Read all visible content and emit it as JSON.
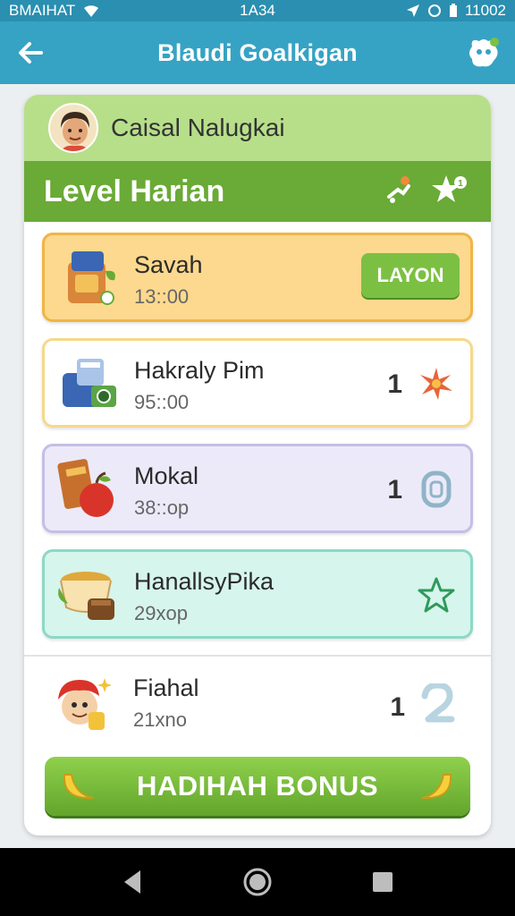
{
  "status_bar": {
    "carrier": "BMAIHAT",
    "time": "1A34",
    "battery": "11002"
  },
  "app_bar": {
    "title": "Blaudi Goalkigan"
  },
  "profile": {
    "name": "Caisal Nalugkai"
  },
  "level": {
    "title": "Level Harian"
  },
  "tasks": [
    {
      "name": "Savah",
      "time": "13::00",
      "action": "LAYON"
    },
    {
      "name": "Hakraly Pim",
      "time": "95::00",
      "count": "1"
    },
    {
      "name": "Mokal",
      "time": "38::op",
      "count": "1"
    },
    {
      "name": "HanallsyPika",
      "time": "29xop"
    },
    {
      "name": "Fiahal",
      "time": "21xno",
      "count": "1"
    }
  ],
  "bonus": {
    "label": "HADIHAH BONUS"
  },
  "colors": {
    "header": "#36a3c4",
    "accent_green": "#6aaa36"
  }
}
